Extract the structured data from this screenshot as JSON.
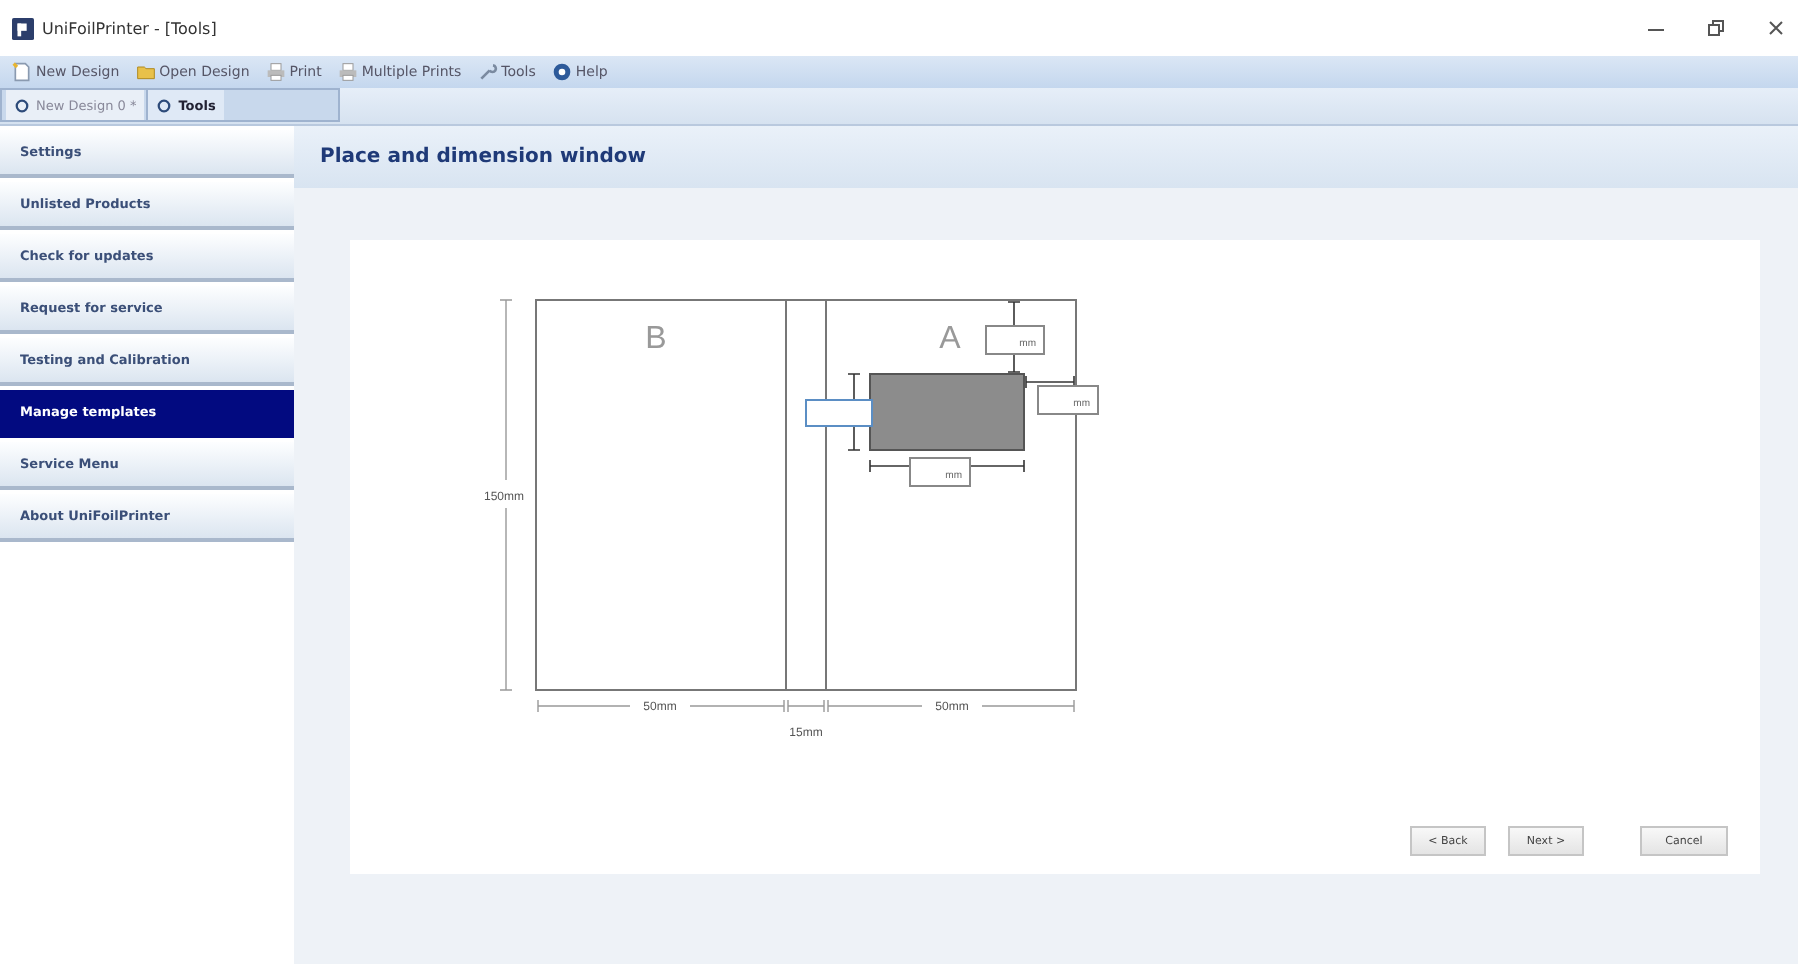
{
  "window": {
    "title": "UniFoilPrinter - [Tools]"
  },
  "toolbar": [
    {
      "label": "New Design",
      "kind": "new"
    },
    {
      "label": "Open Design",
      "kind": "open"
    },
    {
      "label": "Print",
      "kind": "print"
    },
    {
      "label": "Multiple Prints",
      "kind": "print"
    },
    {
      "label": "Tools",
      "kind": "tools"
    },
    {
      "label": "Help",
      "kind": "help"
    }
  ],
  "tabs": [
    {
      "label": "New Design 0 *",
      "selected": false
    },
    {
      "label": "Tools",
      "selected": true
    }
  ],
  "sidebar": {
    "items": [
      {
        "label": "Settings",
        "selected": false
      },
      {
        "label": "Unlisted Products",
        "selected": false
      },
      {
        "label": "Check for updates",
        "selected": false
      },
      {
        "label": "Request for service",
        "selected": false
      },
      {
        "label": "Testing and Calibration",
        "selected": false
      },
      {
        "label": "Manage templates",
        "selected": true
      },
      {
        "label": "Service Menu",
        "selected": false
      },
      {
        "label": "About UniFoilPrinter",
        "selected": false
      }
    ]
  },
  "page_title": "Place and dimension window",
  "diagram": {
    "label_b": "B",
    "label_a": "A",
    "height_label": "150mm",
    "width_b": "50mm",
    "gap": "15mm",
    "width_a": "50mm",
    "fields": [
      {
        "unit": "mm"
      },
      {
        "unit": "mm"
      },
      {
        "unit": "mm"
      }
    ]
  },
  "buttons": [
    {
      "label": "< Back"
    },
    {
      "label": "Next >"
    },
    {
      "label": "Cancel"
    }
  ]
}
